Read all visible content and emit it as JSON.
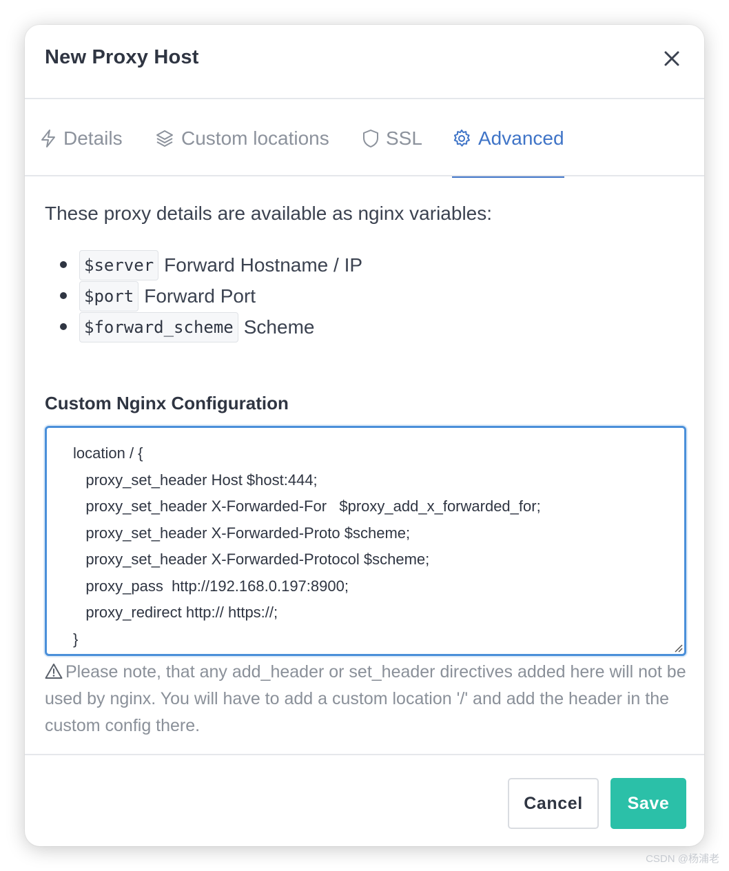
{
  "modal": {
    "title": "New Proxy Host",
    "close_label": "×"
  },
  "tabs": [
    {
      "label": "Details",
      "icon": "lightning-icon",
      "active": false
    },
    {
      "label": "Custom locations",
      "icon": "layers-icon",
      "active": false
    },
    {
      "label": "SSL",
      "icon": "shield-icon",
      "active": false
    },
    {
      "label": "Advanced",
      "icon": "gear-icon",
      "active": true
    }
  ],
  "advanced": {
    "intro": "These proxy details are available as nginx variables:",
    "variables": [
      {
        "code": "$server",
        "desc": "Forward Hostname / IP"
      },
      {
        "code": "$port",
        "desc": "Forward Port"
      },
      {
        "code": "$forward_scheme",
        "desc": "Scheme"
      }
    ],
    "config_label": "Custom Nginx Configuration",
    "config_lines": [
      "location / {",
      "   proxy_set_header Host $host:444;",
      "   proxy_set_header X-Forwarded-For   $proxy_add_x_forwarded_for;",
      "   proxy_set_header X-Forwarded-Proto $scheme;",
      "   proxy_set_header X-Forwarded-Protocol $scheme;",
      "   proxy_pass  http://192.168.0.197:8900;",
      "   proxy_redirect http:// https://;",
      "}"
    ],
    "help_text": "Please note, that any add_header or set_header directives added here will not be used by nginx. You will have to add a custom location '/' and add the header in the custom config there."
  },
  "footer": {
    "cancel_label": "Cancel",
    "save_label": "Save"
  },
  "watermark": "CSDN @杨浦老",
  "colors": {
    "accent": "#3f74c7",
    "save": "#2bc0a8",
    "focus_border": "#4a8fd9"
  }
}
